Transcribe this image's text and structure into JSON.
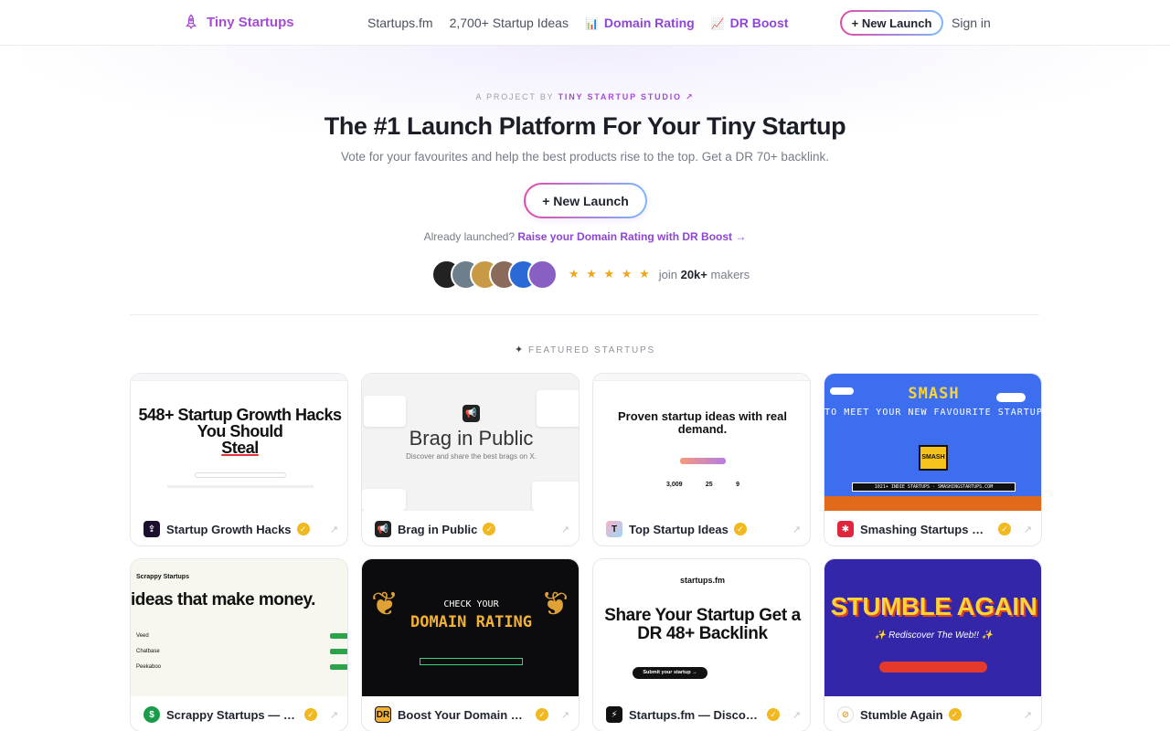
{
  "nav": {
    "brand": "Tiny Startups",
    "links": [
      "Startups.fm",
      "2,700+ Startup Ideas",
      "Domain Rating",
      "DR Boost"
    ],
    "new_launch": "+ New Launch",
    "sign_in": "Sign in"
  },
  "hero": {
    "kicker_prefix": "A PROJECT BY",
    "kicker_studio": "TINY STARTUP STUDIO ↗",
    "headline": "The #1 Launch Platform For Your Tiny Startup",
    "subline": "Vote for your favourites and help the best products rise to the top. Get a DR 70+ backlink.",
    "cta": "+ New Launch",
    "already_prefix": "Already launched?",
    "already_link": "Raise your Domain Rating with DR Boost →",
    "join_prefix": "join",
    "join_count": "20k+",
    "join_suffix": "makers",
    "stars": "★ ★ ★ ★ ★"
  },
  "featured_label": "FEATURED STARTUPS",
  "cards": [
    {
      "name": "Startup Growth Hacks",
      "thumb_title": "548+ Startup Growth Hacks You Should",
      "thumb_title_2": "Steal"
    },
    {
      "name": "Brag in Public",
      "thumb_title": "Brag in Public",
      "thumb_sub": "Discover and share the best brags on X."
    },
    {
      "name": "Top Startup Ideas",
      "thumb_title": "Proven startup ideas with real demand.",
      "stat1": "3,009",
      "stat2": "25",
      "stat3": "9"
    },
    {
      "name": "Smashing Startups — ...",
      "thumb_title": "SMASH",
      "thumb_sub": "TO MEET YOUR NEW FAVOURITE STARTUP",
      "thumb_bar": "1021+ INDIE STARTUPS · SMASHINGSTARTUPS.COM"
    },
    {
      "name": "Scrappy Startups — Pr...",
      "thumb_brand": "Scrappy Startups",
      "thumb_title": "ideas that make money.",
      "rows": [
        "Veed",
        "Chatbase",
        "Peekaboo"
      ]
    },
    {
      "name": "Boost Your Domain Rat...",
      "thumb_kicker": "CHECK YOUR",
      "thumb_title": "DOMAIN RATING"
    },
    {
      "name": "Startups.fm — Discove...",
      "thumb_brand": "startups.fm",
      "thumb_title": "Share Your Startup Get a DR 48+ Backlink",
      "thumb_btn": "Submit your startup →"
    },
    {
      "name": "Stumble Again",
      "thumb_title": "STUMBLE AGAIN",
      "thumb_sub": "✨ Rediscover The Web!! ✨"
    }
  ]
}
